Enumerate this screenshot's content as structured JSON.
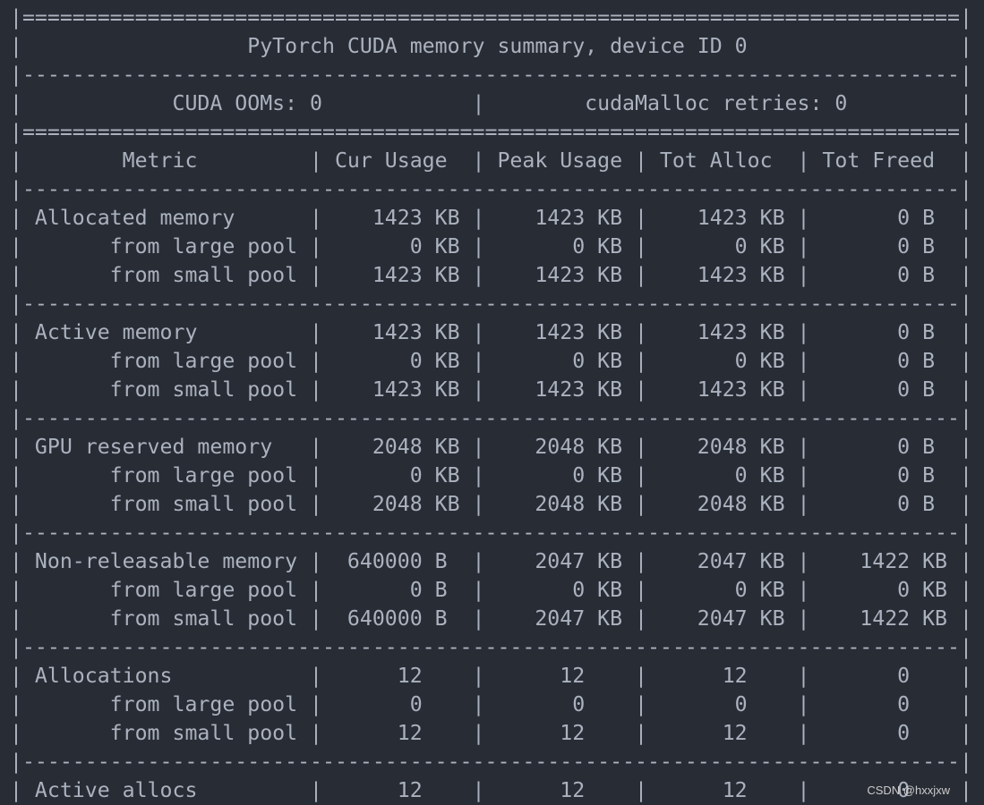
{
  "terminal": {
    "lines": [
      "|===========================================================================|",
      "|                  PyTorch CUDA memory summary, device ID 0                 |",
      "|---------------------------------------------------------------------------|",
      "|            CUDA OOMs: 0            |        cudaMalloc retries: 0         |",
      "|===========================================================================|",
      "|        Metric         | Cur Usage  | Peak Usage | Tot Alloc  | Tot Freed  |",
      "|---------------------------------------------------------------------------|",
      "| Allocated memory      |    1423 KB |    1423 KB |    1423 KB |       0 B  |",
      "|       from large pool |       0 KB |       0 KB |       0 KB |       0 B  |",
      "|       from small pool |    1423 KB |    1423 KB |    1423 KB |       0 B  |",
      "|---------------------------------------------------------------------------|",
      "| Active memory         |    1423 KB |    1423 KB |    1423 KB |       0 B  |",
      "|       from large pool |       0 KB |       0 KB |       0 KB |       0 B  |",
      "|       from small pool |    1423 KB |    1423 KB |    1423 KB |       0 B  |",
      "|---------------------------------------------------------------------------|",
      "| GPU reserved memory   |    2048 KB |    2048 KB |    2048 KB |       0 B  |",
      "|       from large pool |       0 KB |       0 KB |       0 KB |       0 B  |",
      "|       from small pool |    2048 KB |    2048 KB |    2048 KB |       0 B  |",
      "|---------------------------------------------------------------------------|",
      "| Non-releasable memory |  640000 B  |    2047 KB |    2047 KB |    1422 KB |",
      "|       from large pool |       0 B  |       0 KB |       0 KB |       0 KB |",
      "|       from small pool |  640000 B  |    2047 KB |    2047 KB |    1422 KB |",
      "|---------------------------------------------------------------------------|",
      "| Allocations           |      12    |      12    |      12    |       0    |",
      "|       from large pool |       0    |       0    |       0    |       0    |",
      "|       from small pool |      12    |      12    |      12    |       0    |",
      "|---------------------------------------------------------------------------|",
      "| Active allocs         |      12    |      12    |      12    |       0    |"
    ]
  },
  "watermark": "CSDN @hxxjxw",
  "colors": {
    "background": "#282c34",
    "text": "#abb2bf"
  }
}
